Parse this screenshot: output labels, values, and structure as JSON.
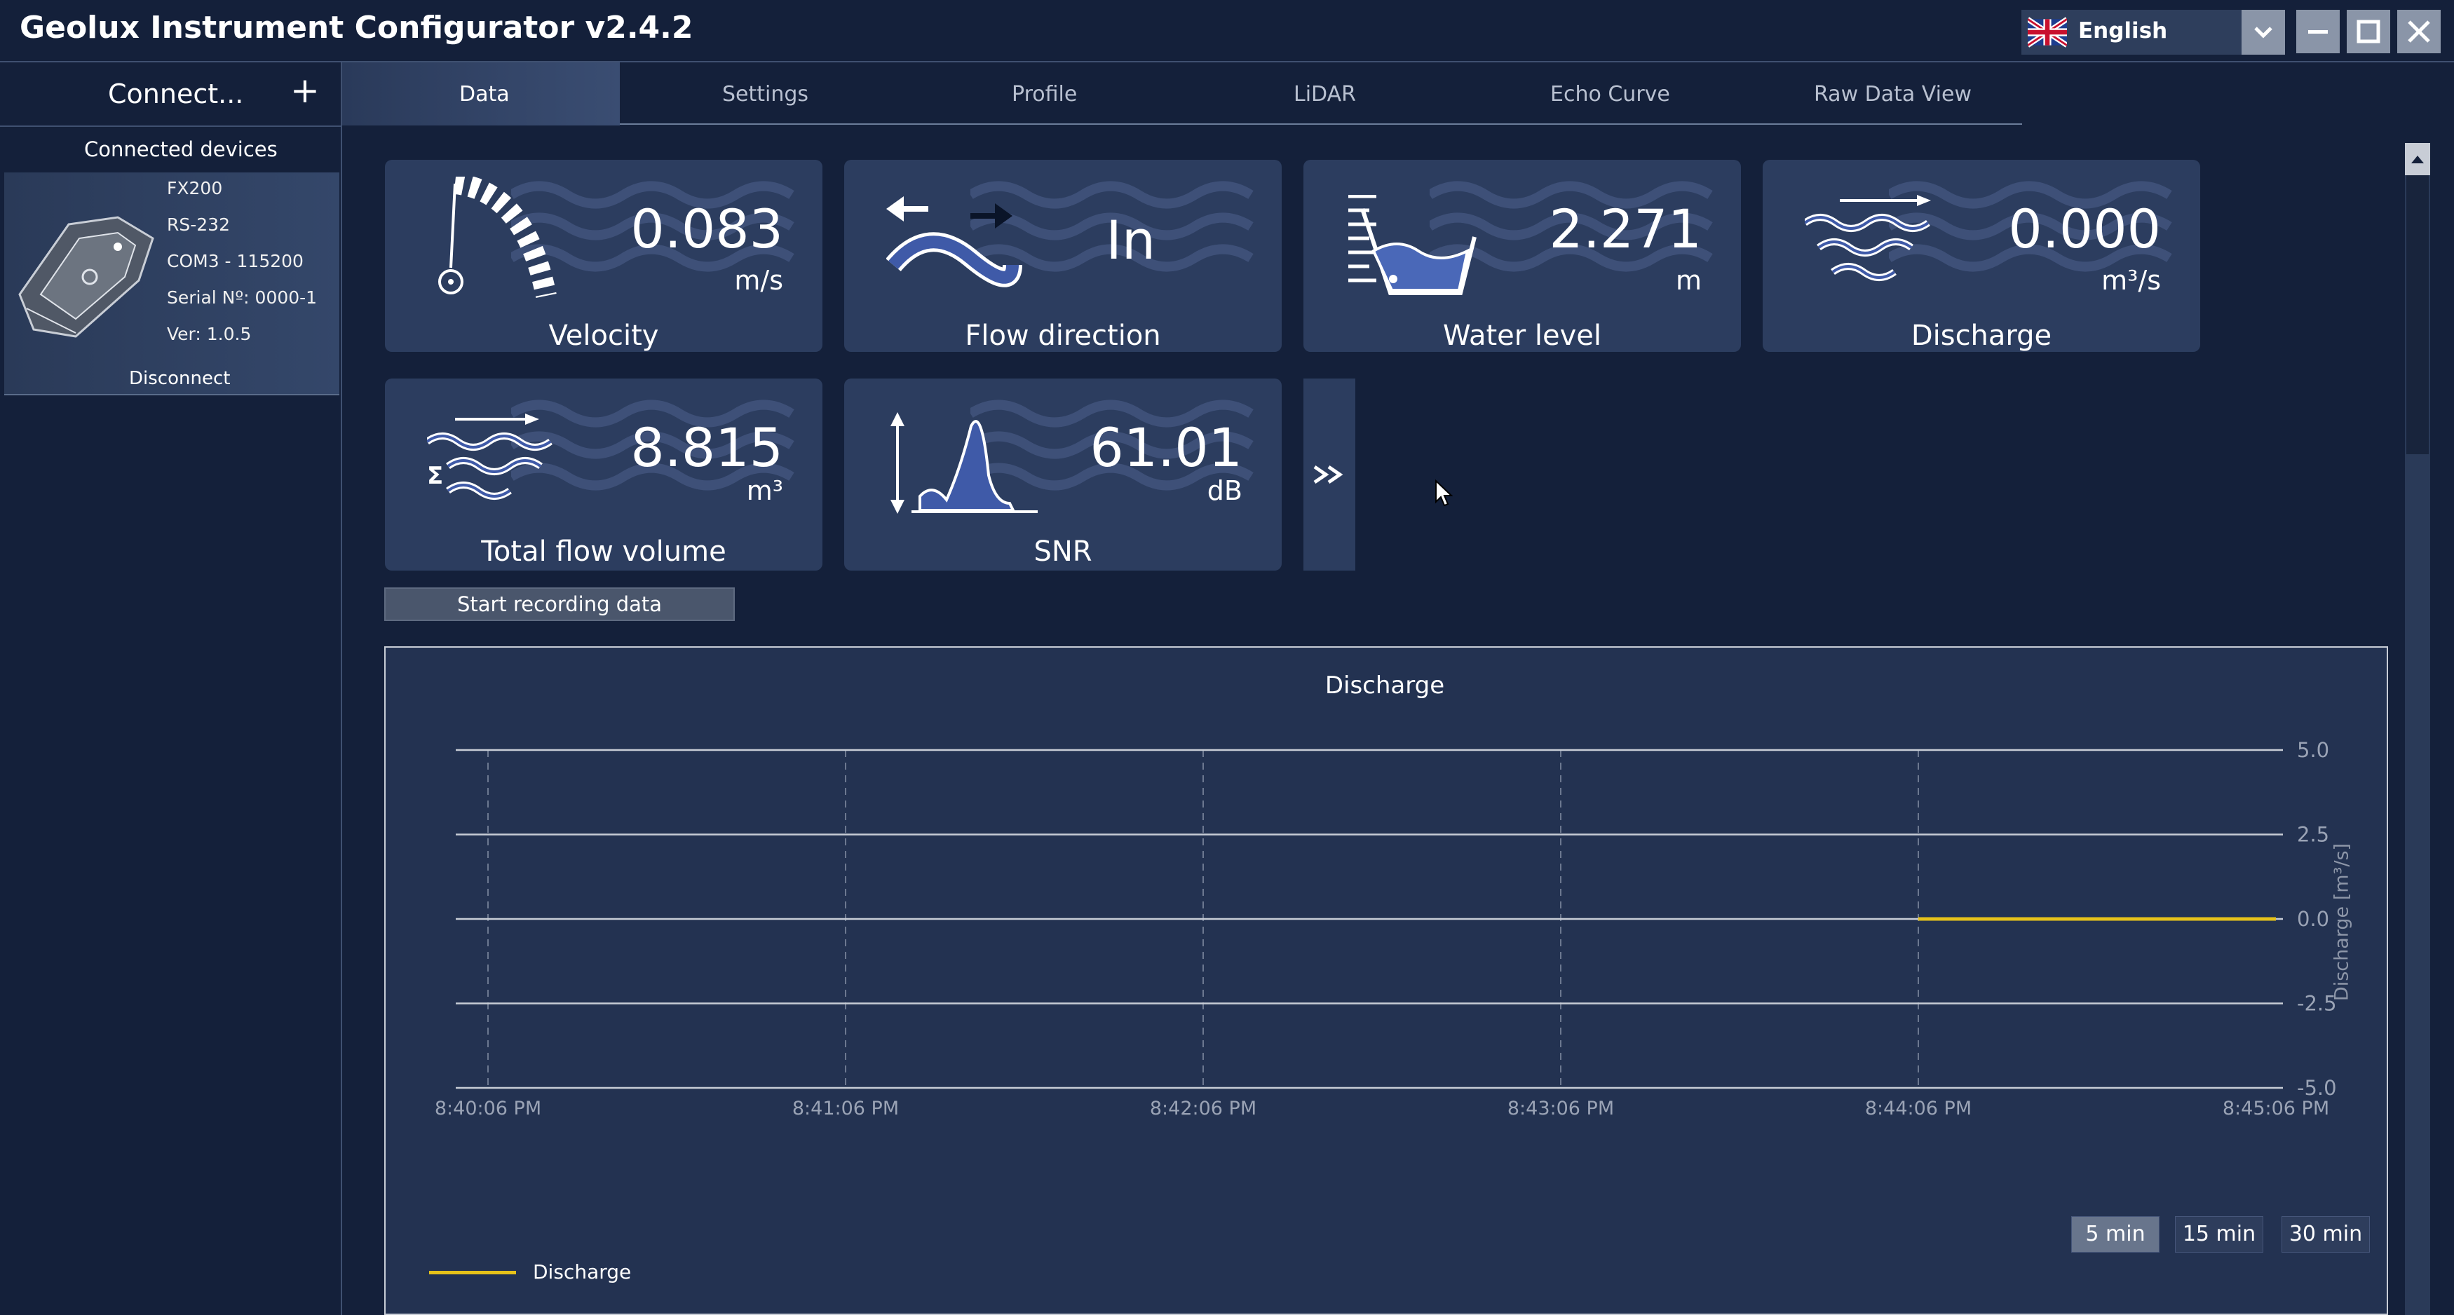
{
  "window": {
    "title": "Geolux Instrument Configurator v2.4.2",
    "language": "English"
  },
  "sidebar": {
    "connect_label": "Connect...",
    "connected_devices_title": "Connected devices",
    "device": {
      "model": "FX200",
      "interface": "RS-232",
      "port": "COM3 - 115200",
      "serial": "Serial Nº: 0000-1",
      "version": "Ver:  1.0.5",
      "disconnect_label": "Disconnect"
    }
  },
  "tabs": [
    "Data",
    "Settings",
    "Profile",
    "LiDAR",
    "Echo Curve",
    "Raw Data View"
  ],
  "tiles": [
    {
      "value": "0.083",
      "unit": "m/s",
      "label": "Velocity",
      "icon": "velocity-gauge-icon"
    },
    {
      "value": "In",
      "unit": "",
      "label": "Flow direction",
      "icon": "flow-direction-icon"
    },
    {
      "value": "2.271",
      "unit": "m",
      "label": "Water level",
      "icon": "water-level-icon"
    },
    {
      "value": "0.000",
      "unit": "m³/s",
      "label": "Discharge",
      "icon": "discharge-icon"
    },
    {
      "value": "8.815",
      "unit": "m³",
      "label": "Total flow volume",
      "icon": "total-flow-icon"
    },
    {
      "value": "61.01",
      "unit": "dB",
      "label": "SNR",
      "icon": "snr-icon"
    }
  ],
  "record_button": "Start recording data",
  "range_buttons": [
    "5 min",
    "15 min",
    "30 min"
  ],
  "active_range": "5 min",
  "chart_data": {
    "type": "line",
    "title": "Discharge",
    "ylabel": "Discharge [m³/s]",
    "ylim": [
      -5.0,
      5.0
    ],
    "yticks": [
      "5.0",
      "2.5",
      "0.0",
      "-2.5",
      "-5.0"
    ],
    "xticks": [
      "8:40:06 PM",
      "8:41:06 PM",
      "8:42:06 PM",
      "8:43:06 PM",
      "8:44:06 PM",
      "8:45:06 PM"
    ],
    "grid": true,
    "legend_position": "bottom-left",
    "series": [
      {
        "name": "Discharge",
        "color": "#e6c21a",
        "x": [
          "8:44:06 PM",
          "8:45:06 PM"
        ],
        "values": [
          0.0,
          0.0
        ]
      }
    ]
  }
}
